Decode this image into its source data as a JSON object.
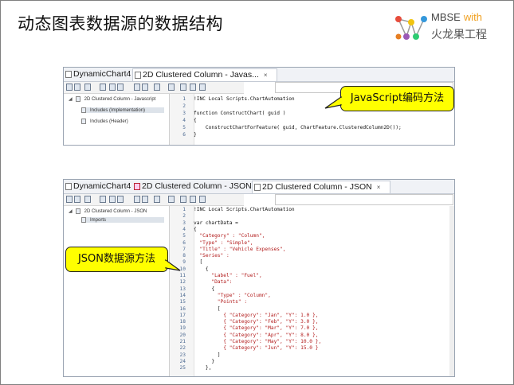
{
  "slide": {
    "title": "动态图表数据源的数据结构",
    "logo_line1": "MBSE",
    "logo_with": "with",
    "logo_line2": "火龙果工程"
  },
  "window1": {
    "tabs": [
      {
        "label": "DynamicChart4",
        "active": false,
        "icon": "diagram-icon"
      },
      {
        "label": "2D Clustered Column - Javas...",
        "active": true,
        "icon": "script-icon",
        "close": "×"
      }
    ],
    "tree": [
      {
        "label": "2D Clustered Column - Javascript",
        "expanded": true,
        "selected": false
      },
      {
        "label": "Includes (Implementation)",
        "selected": true
      },
      {
        "label": "Includes (Header)",
        "selected": false
      }
    ],
    "code_lines": [
      {
        "n": "1",
        "text": "!INC Local Scripts.ChartAutomation"
      },
      {
        "n": "2",
        "text": ""
      },
      {
        "n": "3",
        "text": "function ConstructChart( guid )"
      },
      {
        "n": "4",
        "text": "{"
      },
      {
        "n": "5",
        "text": "    ConstructChartForFeature( guid, ChartFeature.ClusteredColumn2D());"
      },
      {
        "n": "6",
        "text": "}"
      }
    ],
    "callout": "JavaScript编码方法"
  },
  "window2": {
    "tabs": [
      {
        "label": "DynamicChart4",
        "active": false,
        "icon": "diagram-icon"
      },
      {
        "label": "2D Clustered Column - JSON",
        "active": false,
        "icon": "chart-icon"
      },
      {
        "label": "2D Clustered Column - JSON",
        "active": true,
        "icon": "script-icon",
        "close": "×"
      }
    ],
    "tree": [
      {
        "label": "2D Clustered Column - JSON",
        "expanded": true,
        "selected": false
      },
      {
        "label": "Imports",
        "selected": true
      }
    ],
    "code_lines": [
      {
        "n": "1",
        "text": "!INC Local Scripts.ChartAutomation"
      },
      {
        "n": "2",
        "text": ""
      },
      {
        "n": "3",
        "text": "var chartData ="
      },
      {
        "n": "4",
        "text": "{"
      },
      {
        "n": "5",
        "text": "  \"Category\" : \"Column\","
      },
      {
        "n": "6",
        "text": "  \"Type\" : \"Simple\","
      },
      {
        "n": "7",
        "text": "  \"Title\" : \"Vehicle Expenses\","
      },
      {
        "n": "8",
        "text": "  \"Series\" :"
      },
      {
        "n": "9",
        "text": "  ["
      },
      {
        "n": "10",
        "text": "    {"
      },
      {
        "n": "11",
        "text": "      \"Label\" : \"Fuel\","
      },
      {
        "n": "12",
        "text": "      \"Data\":"
      },
      {
        "n": "13",
        "text": "      {"
      },
      {
        "n": "14",
        "text": "        \"Type\" : \"Column\","
      },
      {
        "n": "15",
        "text": "        \"Points\" :"
      },
      {
        "n": "16",
        "text": "        ["
      },
      {
        "n": "17",
        "text": "          { \"Category\": \"Jan\", \"Y\": 1.0 },"
      },
      {
        "n": "18",
        "text": "          { \"Category\": \"Feb\", \"Y\": 3.0 },"
      },
      {
        "n": "19",
        "text": "          { \"Category\": \"Mar\", \"Y\": 7.0 },"
      },
      {
        "n": "20",
        "text": "          { \"Category\": \"Apr\", \"Y\": 8.0 },"
      },
      {
        "n": "21",
        "text": "          { \"Category\": \"May\", \"Y\": 10.0 },"
      },
      {
        "n": "22",
        "text": "          { \"Category\": \"Jun\", \"Y\": 15.0 }"
      },
      {
        "n": "23",
        "text": "        ]"
      },
      {
        "n": "24",
        "text": "      }"
      },
      {
        "n": "25",
        "text": "    },"
      }
    ],
    "callout": "JSON数据源方法"
  },
  "colors": {
    "callout_fill": "#ffff00",
    "line_number": "#4d6a92",
    "keyword": "#00008b",
    "string": "#b21b1b"
  }
}
